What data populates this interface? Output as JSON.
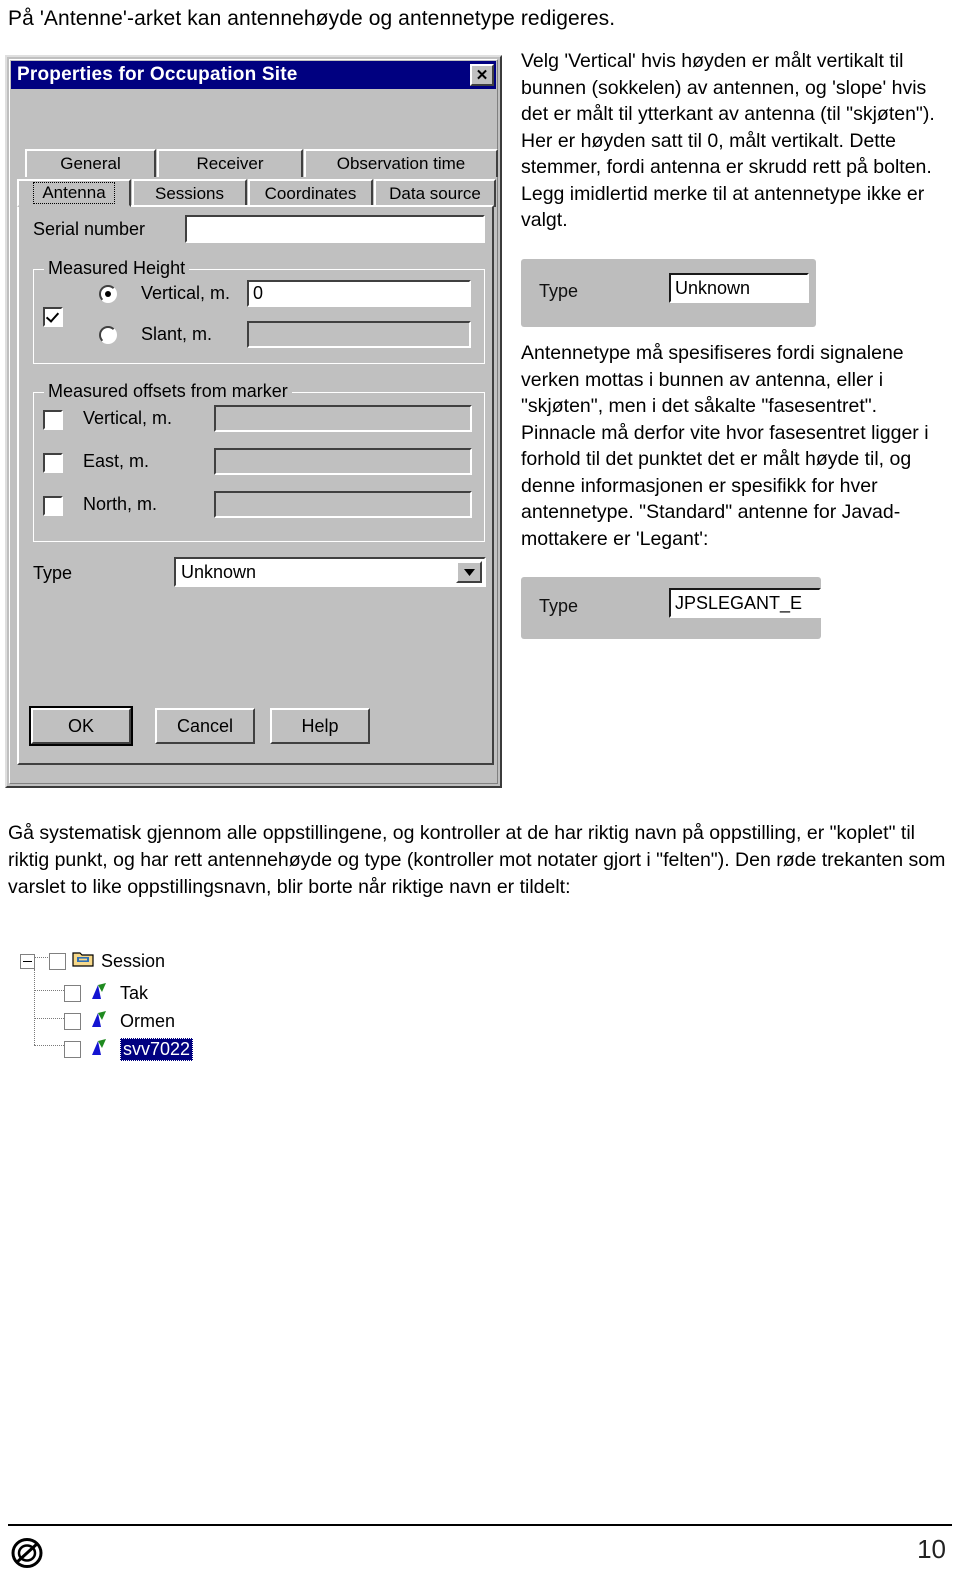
{
  "document": {
    "intro": "På 'Antenne'-arket kan antennehøyde og antennetype redigeres.",
    "below_paragraph": "Gå systematisk gjennom alle oppstillingene, og kontroller at de har riktig navn på oppstilling, er \"koplet\" til riktig punkt, og har rett antennehøyde og type (kontroller mot notater gjort i \"felten\"). Den røde trekanten som varslet to like oppstillingsnavn, blir borte når riktige navn er tildelt:",
    "page_number": "10"
  },
  "right_column": {
    "paragraph1": "Velg 'Vertical' hvis høyden er målt vertikalt til bunnen (sokkelen) av antennen, og 'slope' hvis det er målt til ytterkant av antenna (til \"skjøten\"). Her er høyden satt til 0, målt vertikalt. Dette stemmer, fordi antenna er skrudd rett på bolten. Legg imidlertid merke til at antennetype ikke er valgt.",
    "paragraph2": "Antennetype må spesifiseres fordi signalene verken mottas i bunnen av antenna, eller i \"skjøten\", men i det såkalte \"fasesentret\". Pinnacle må derfor vite hvor fasesentret ligger i forhold til det punktet det er målt høyde til, og denne informasjonen er spesifikk for hver antennetype. \"Standard\" antenne for Javad-mottakere er 'Legant':"
  },
  "fragments": [
    {
      "label": "Type",
      "value": "Unknown"
    },
    {
      "label": "Type",
      "value": "JPSLEGANT_E"
    }
  ],
  "dialog": {
    "title": "Properties for Occupation Site",
    "close_label": "✕",
    "tabs_row1": [
      {
        "label": "General",
        "active": false
      },
      {
        "label": "Receiver",
        "active": false
      },
      {
        "label": "Observation time",
        "active": false
      }
    ],
    "tabs_row2": [
      {
        "label": "Antenna",
        "active": true
      },
      {
        "label": "Sessions",
        "active": false
      },
      {
        "label": "Coordinates",
        "active": false
      },
      {
        "label": "Data source",
        "active": false
      }
    ],
    "serial_number": {
      "label": "Serial number",
      "value": ""
    },
    "measured_height": {
      "group_label": "Measured Height",
      "enabled": true,
      "vertical": {
        "label": "Vertical, m.",
        "value": "0",
        "selected": true
      },
      "slant": {
        "label": "Slant, m.",
        "value": "",
        "selected": false
      }
    },
    "measured_offsets": {
      "group_label": "Measured offsets from marker",
      "rows": [
        {
          "label": "Vertical, m.",
          "value": "",
          "checked": false
        },
        {
          "label": "East, m.",
          "value": "",
          "checked": false
        },
        {
          "label": "North, m.",
          "value": "",
          "checked": false
        }
      ]
    },
    "type": {
      "label": "Type",
      "value": "Unknown"
    },
    "buttons": [
      {
        "label": "OK",
        "default": true
      },
      {
        "label": "Cancel",
        "default": false
      },
      {
        "label": "Help",
        "default": false
      }
    ]
  },
  "tree": {
    "root": {
      "label": "Session",
      "expanded": true,
      "checked": false
    },
    "children": [
      {
        "label": "Tak",
        "checked": false,
        "selected": false
      },
      {
        "label": "Ormen",
        "checked": false,
        "selected": false
      },
      {
        "label": "svv7022",
        "checked": false,
        "selected": true
      }
    ]
  },
  "colors": {
    "titlebar": "#000080",
    "dialog_face": "#c0c0c0",
    "selection": "#000080",
    "fragment_bg": "#bdbdbd"
  }
}
